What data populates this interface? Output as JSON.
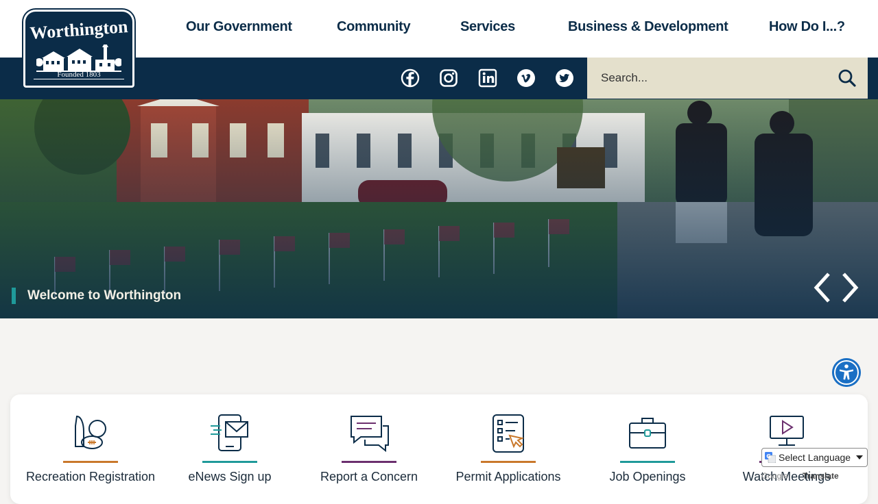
{
  "logo": {
    "name": "Worthington",
    "founded": "Founded 1803"
  },
  "nav": {
    "items": [
      {
        "label": "Our Government"
      },
      {
        "label": "Community"
      },
      {
        "label": "Services"
      },
      {
        "label": "Business & Development"
      },
      {
        "label": "How Do I...?"
      }
    ]
  },
  "social": {
    "icons": [
      "facebook-icon",
      "instagram-icon",
      "linkedin-icon",
      "vimeo-icon",
      "twitter-icon"
    ]
  },
  "search": {
    "placeholder": "Search..."
  },
  "hero": {
    "caption": "Welcome to Worthington"
  },
  "quick_links": [
    {
      "label": "Recreation Registration",
      "icon": "recreation-icon",
      "accent": "#c9782b"
    },
    {
      "label": "eNews Sign up",
      "icon": "enews-icon",
      "accent": "#1f9a9a"
    },
    {
      "label": "Report a Concern",
      "icon": "report-concern-icon",
      "accent": "#6b2f6e"
    },
    {
      "label": "Permit Applications",
      "icon": "permit-icon",
      "accent": "#c9782b"
    },
    {
      "label": "Job Openings",
      "icon": "briefcase-icon",
      "accent": "#1f9a9a"
    },
    {
      "label": "Watch Meetings",
      "icon": "video-icon",
      "accent": "#6b2f6e"
    }
  ],
  "translate": {
    "select_label": "Select Language",
    "powered_by": "Google",
    "translate_label": "Translate"
  },
  "colors": {
    "navy": "#0b2c48",
    "teal": "#1f9a9a",
    "orange": "#c9782b",
    "purple": "#6b2f6e",
    "search_bg": "#e4e0cc"
  }
}
